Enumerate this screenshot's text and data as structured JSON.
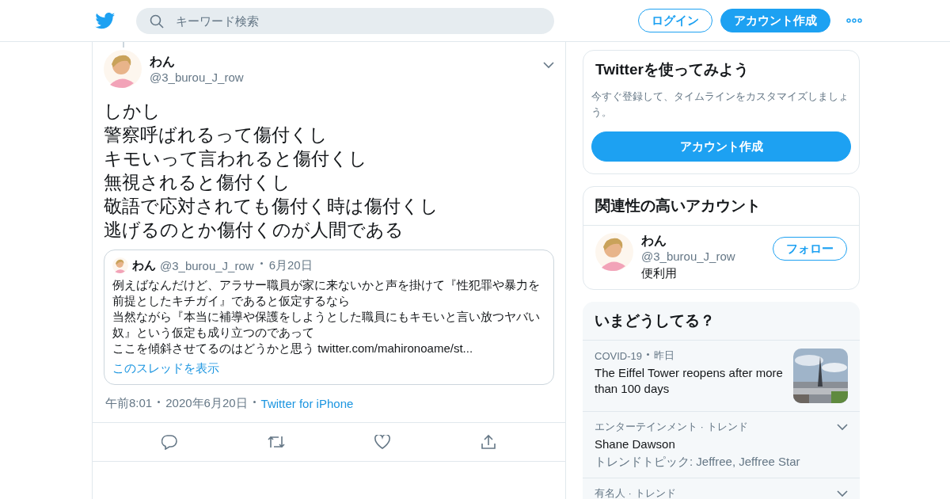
{
  "header": {
    "search": {
      "placeholder": "キーワード検索"
    },
    "login_button": "ログイン",
    "signup_button": "アカウント作成"
  },
  "tweet": {
    "name": "わん",
    "handle": "@3_burou_J_row",
    "lines": [
      "しかし",
      "警察呼ばれるって傷付くし",
      "キモいって言われると傷付くし",
      "無視されると傷付くし",
      "敬語で応対されても傷付く時は傷付くし",
      "逃げるのとか傷付くのが人間である"
    ],
    "quote": {
      "name": "わん",
      "handle": "@3_burou_J_row",
      "date": "6月20日",
      "paragraphs": [
        "例えばなんだけど、アラサー職員が家に来ないかと声を掛けて『性犯罪や暴力を前提としたキチガイ』であると仮定するなら",
        "当然ながら『本当に補導や保護をしようとした職員にもキモいと言い放つヤバい奴』という仮定も成り立つのであって",
        "ここを傾斜させてるのはどうかと思う twitter.com/mahironoame/st..."
      ],
      "thread_link": "このスレッドを表示"
    },
    "time": "午前8:01",
    "date": "2020年6月20日",
    "source": "Twitter for iPhone"
  },
  "signup_card": {
    "title": "Twitterを使ってみよう",
    "text": "今すぐ登録して、タイムラインをカスタマイズしましょう。",
    "button": "アカウント作成"
  },
  "related_card": {
    "title": "関連性の高いアカウント",
    "accounts": [
      {
        "name": "わん",
        "handle": "@3_burou_J_row",
        "bio": "便利用",
        "button": "フォロー"
      }
    ]
  },
  "trends_card": {
    "title": "いまどうしてる？",
    "items": [
      {
        "kind": "news",
        "meta": "COVID-19",
        "time": "昨日",
        "title": "The Eiffel Tower reopens after more than 100 days"
      },
      {
        "kind": "trend",
        "meta": "エンターテインメント · トレンド",
        "title": "Shane Dawson",
        "sub": "トレンドトピック: Jeffree, Jeffree Star"
      },
      {
        "kind": "trend",
        "meta": "有名人 · トレンド"
      }
    ]
  }
}
